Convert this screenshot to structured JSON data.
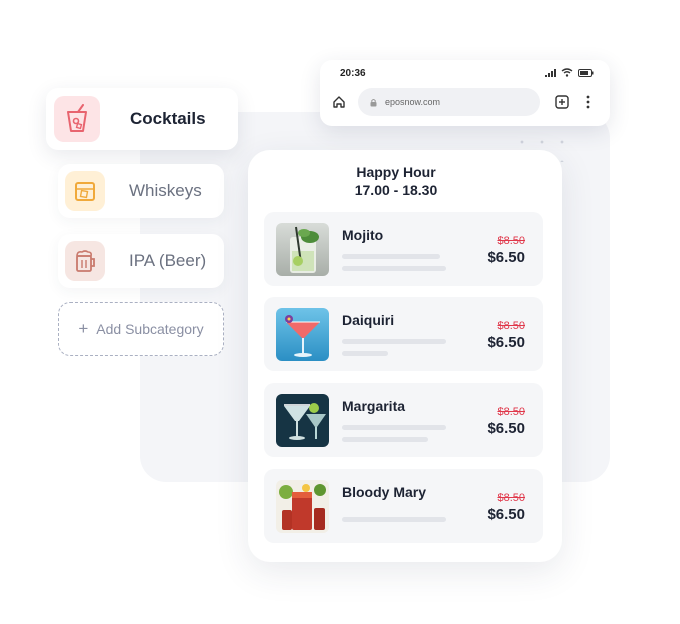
{
  "sidebar": {
    "items": [
      {
        "label": "Cocktails",
        "icon": "cocktail-icon",
        "active": true
      },
      {
        "label": "Whiskeys",
        "icon": "whiskey-icon",
        "active": false
      },
      {
        "label": "IPA (Beer)",
        "icon": "beer-mug-icon",
        "active": false
      }
    ],
    "add_label": "Add Subcategory"
  },
  "browser": {
    "time": "20:36",
    "url": "eposnow.com"
  },
  "menu": {
    "title": "Happy Hour",
    "hours": "17.00 - 18.30",
    "items": [
      {
        "name": "Mojito",
        "old_price": "$8.50",
        "price": "$6.50"
      },
      {
        "name": "Daiquiri",
        "old_price": "$8.50",
        "price": "$6.50"
      },
      {
        "name": "Margarita",
        "old_price": "$8.50",
        "price": "$6.50"
      },
      {
        "name": "Bloody Mary",
        "old_price": "$8.50",
        "price": "$6.50"
      }
    ]
  },
  "colors": {
    "accent_red": "#e0374a",
    "cocktail_bg": "#fde4e6",
    "whiskey_bg": "#fff0d6",
    "beer_bg": "#f6e6e2"
  }
}
